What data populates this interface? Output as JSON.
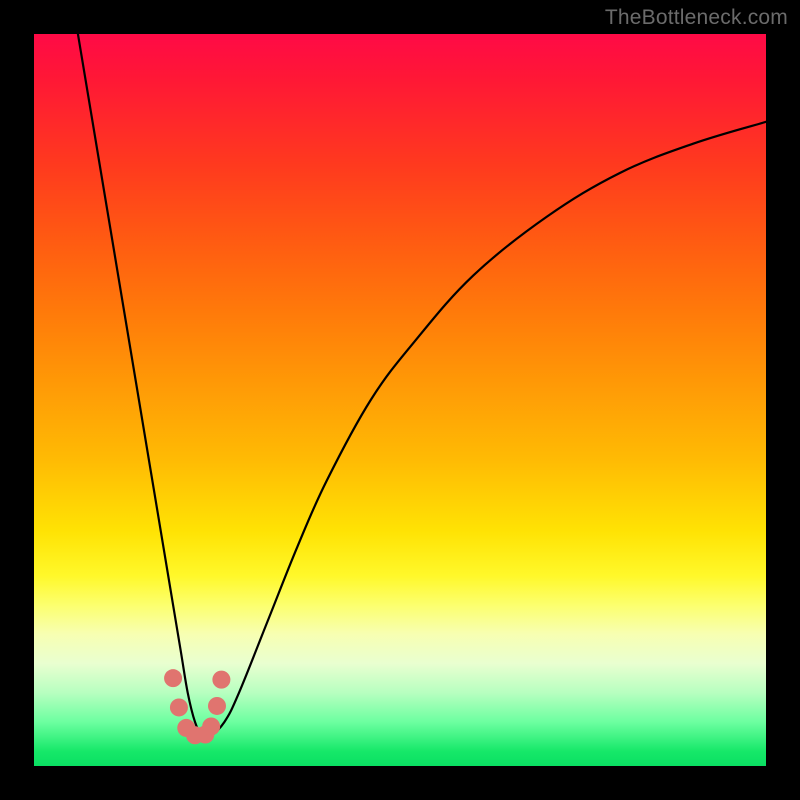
{
  "watermark": "TheBottleneck.com",
  "colors": {
    "frame": "#000000",
    "curve": "#000000",
    "dots": "#e0746f"
  },
  "chart_data": {
    "type": "line",
    "title": "",
    "xlabel": "",
    "ylabel": "",
    "xlim": [
      0,
      100
    ],
    "ylim": [
      0,
      100
    ],
    "grid": false,
    "series": [
      {
        "name": "bottleneck-curve",
        "x": [
          6,
          8,
          10,
          12,
          14,
          16,
          18,
          20,
          21,
          22,
          23,
          24,
          26,
          28,
          32,
          36,
          40,
          46,
          52,
          60,
          70,
          80,
          90,
          100
        ],
        "values": [
          100,
          88,
          76,
          64,
          52,
          40,
          28,
          16,
          10,
          6,
          4,
          4,
          6,
          10,
          20,
          30,
          39,
          50,
          58,
          67,
          75,
          81,
          85,
          88
        ]
      }
    ],
    "marker_points": {
      "name": "highlight-dots",
      "x": [
        19.0,
        19.8,
        20.8,
        22.0,
        23.4,
        24.2,
        25.0,
        25.6
      ],
      "values": [
        12.0,
        8.0,
        5.2,
        4.2,
        4.3,
        5.4,
        8.2,
        11.8
      ]
    }
  }
}
